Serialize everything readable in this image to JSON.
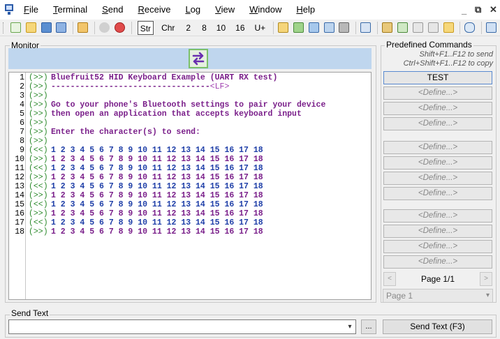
{
  "menu": [
    "File",
    "Terminal",
    "Send",
    "Receive",
    "Log",
    "View",
    "Window",
    "Help"
  ],
  "menu_underline": [
    "F",
    "T",
    "S",
    "R",
    "L",
    "V",
    "W",
    "H"
  ],
  "window_controls": [
    "_",
    "⧉",
    "✕"
  ],
  "toolbar": {
    "str_label": "Str",
    "chr_label": "Chr",
    "radix": [
      "2",
      "8",
      "10",
      "16",
      "U+"
    ]
  },
  "monitor": {
    "label": "Monitor",
    "lines": [
      {
        "n": "1",
        "dir": "(>>)",
        "text": "Bluefruit52 HID Keyboard Example (UART RX test)",
        "kind": "rx",
        "suffix": ""
      },
      {
        "n": "2",
        "dir": "(>>)",
        "text": "---------------------------------",
        "kind": "rx",
        "suffix": "<LF>"
      },
      {
        "n": "3",
        "dir": "(>>)",
        "text": "",
        "kind": "rx",
        "suffix": ""
      },
      {
        "n": "4",
        "dir": "(>>)",
        "text": "Go to your phone's Bluetooth settings to pair your device",
        "kind": "rx",
        "suffix": ""
      },
      {
        "n": "5",
        "dir": "(>>)",
        "text": "then open an application that accepts keyboard input",
        "kind": "rx",
        "suffix": ""
      },
      {
        "n": "6",
        "dir": "(>>)",
        "text": "",
        "kind": "rx",
        "suffix": ""
      },
      {
        "n": "7",
        "dir": "(>>)",
        "text": "Enter the character(s) to send:",
        "kind": "rx",
        "suffix": ""
      },
      {
        "n": "8",
        "dir": "(>>)",
        "text": "",
        "kind": "rx",
        "suffix": ""
      },
      {
        "n": "9",
        "dir": "(<<)",
        "text": "1 2 3 4 5 6 7 8 9 10 11 12 13 14 15 16 17 18",
        "kind": "tx",
        "suffix": ""
      },
      {
        "n": "10",
        "dir": "(>>)",
        "text": "1 2 3 4 5 6 7 8 9 10 11 12 13 14 15 16 17 18",
        "kind": "rx",
        "suffix": ""
      },
      {
        "n": "11",
        "dir": "(<<)",
        "text": "1 2 3 4 5 6 7 8 9 10 11 12 13 14 15 16 17 18",
        "kind": "tx",
        "suffix": ""
      },
      {
        "n": "12",
        "dir": "(>>)",
        "text": "1 2 3 4 5 6 7 8 9 10 11 12 13 14 15 16 17 18",
        "kind": "rx",
        "suffix": ""
      },
      {
        "n": "13",
        "dir": "(<<)",
        "text": "1 2 3 4 5 6 7 8 9 10 11 12 13 14 15 16 17 18",
        "kind": "tx",
        "suffix": ""
      },
      {
        "n": "14",
        "dir": "(>>)",
        "text": "1 2 3 4 5 6 7 8 9 10 11 12 13 14 15 16 17 18",
        "kind": "rx",
        "suffix": ""
      },
      {
        "n": "15",
        "dir": "(<<)",
        "text": "1 2 3 4 5 6 7 8 9 10 11 12 13 14 15 16 17 18",
        "kind": "tx",
        "suffix": ""
      },
      {
        "n": "16",
        "dir": "(>>)",
        "text": "1 2 3 4 5 6 7 8 9 10 11 12 13 14 15 16 17 18",
        "kind": "rx",
        "suffix": ""
      },
      {
        "n": "17",
        "dir": "(<<)",
        "text": "1 2 3 4 5 6 7 8 9 10 11 12 13 14 15 16 17 18",
        "kind": "tx",
        "suffix": ""
      },
      {
        "n": "18",
        "dir": "(>>)",
        "text": "1 2 3 4 5 6 7 8 9 10 11 12 13 14 15 16 17 18",
        "kind": "rx",
        "suffix": ""
      }
    ]
  },
  "predefined": {
    "label": "Predefined Commands",
    "hint_send": "Shift+F1..F12 to send",
    "hint_copy": "Ctrl+Shift+F1..F12 to copy",
    "commands": [
      "TEST",
      "<Define...>",
      "<Define...>",
      "<Define...>",
      "<Define...>",
      "<Define...>",
      "<Define...>",
      "<Define...>",
      "<Define...>",
      "<Define...>",
      "<Define...>",
      "<Define...>"
    ],
    "page_info": "Page 1/1",
    "page_select": "Page 1"
  },
  "send": {
    "label": "Send Text",
    "input_value": "",
    "ellipsis_label": "...",
    "button_label": "Send Text (F3)"
  },
  "colors": {
    "rx_text": "#7a1f8a",
    "tx_text": "#1f3fa8",
    "direction": "#2e8b2e",
    "swap_bar": "#bfd6ee"
  }
}
